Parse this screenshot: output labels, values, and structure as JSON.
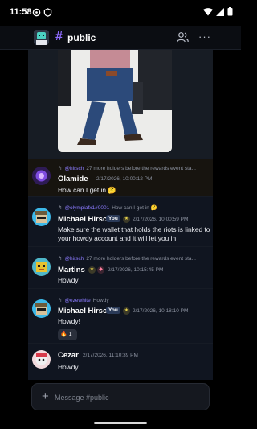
{
  "status_bar": {
    "time": "11:58"
  },
  "header": {
    "hash_symbol": "#",
    "channel_name": "public",
    "more_glyph": "···"
  },
  "messages": [
    {
      "reply_mention": "@hirsch",
      "reply_text": "27 more holders before the rewards event sta...",
      "author": "Olamide",
      "time": "2/17/2026, 10:00:12 PM",
      "text": "How can I get in 🤔"
    },
    {
      "reply_mention": "@olympiafx1#0001",
      "reply_text": "How can I get in 🤔",
      "author": "Michael Hirsch",
      "you_label": "You",
      "time": "2/17/2026, 10:00:59 PM",
      "text": "Make sure the wallet that holds the riots is linked to your howdy account and it will let you in"
    },
    {
      "reply_mention": "@hirsch",
      "reply_text": "27 more holders before the rewards event sta...",
      "author": "Martins",
      "time": "2/17/2026, 10:15:45 PM",
      "text": "Howdy"
    },
    {
      "reply_mention": "@ezewhite",
      "reply_text": "Howdy",
      "author": "Michael Hirsch",
      "you_label": "You",
      "time": "2/17/2026, 10:18:10 PM",
      "text": "Howdy!",
      "reaction": {
        "emoji": "🔥",
        "count": "1"
      }
    },
    {
      "author": "Cezar",
      "time": "2/17/2026, 11:10:39 PM",
      "text": "Howdy"
    }
  ],
  "composer": {
    "placeholder": "Message #public",
    "plus": "+"
  },
  "colors": {
    "accent": "#8f6bff",
    "mention": "#8b7bff",
    "background": "#0d1118"
  }
}
